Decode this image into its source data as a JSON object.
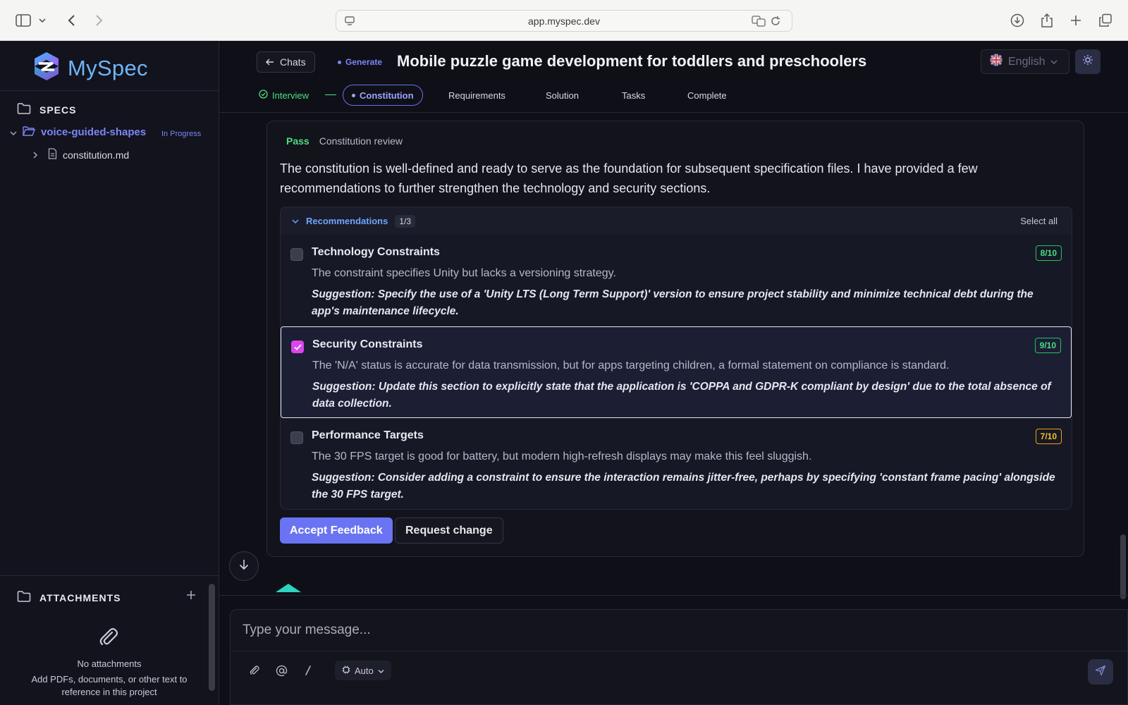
{
  "browser": {
    "url": "app.myspec.dev"
  },
  "sidebar": {
    "logo_text": "MySpec",
    "specs_heading": "SPECS",
    "project": {
      "name": "voice-guided-shapes",
      "status": "In Progress"
    },
    "files": [
      {
        "name": "constitution.md"
      }
    ],
    "attachments": {
      "heading": "ATTACHMENTS",
      "empty_title": "No attachments",
      "empty_hint": "Add PDFs, documents, or other text to reference in this project"
    }
  },
  "header": {
    "back_label": "Chats",
    "mode_tag": "Generate",
    "title": "Mobile puzzle game development for toddlers and preschoolers",
    "language": "English"
  },
  "steps": [
    {
      "label": "Interview",
      "state": "done"
    },
    {
      "label": "Constitution",
      "state": "active"
    },
    {
      "label": "Requirements",
      "state": "pending"
    },
    {
      "label": "Solution",
      "state": "pending"
    },
    {
      "label": "Tasks",
      "state": "pending"
    },
    {
      "label": "Complete",
      "state": "pending"
    }
  ],
  "review": {
    "status": "Pass",
    "label": "Constitution review",
    "summary": "The constitution is well-defined and ready to serve as the foundation for subsequent specification files. I have provided a few recommendations to further strengthen the technology and security sections.",
    "recommendations": {
      "title": "Recommendations",
      "count": "1/3",
      "select_all": "Select all",
      "items": [
        {
          "title": "Technology Constraints",
          "score": "8/10",
          "checked": false,
          "description": "The constraint specifies Unity but lacks a versioning strategy.",
          "suggestion": "Suggestion: Specify the use of a 'Unity LTS (Long Term Support)' version to ensure project stability and minimize technical debt during the app's maintenance lifecycle."
        },
        {
          "title": "Security Constraints",
          "score": "9/10",
          "checked": true,
          "description": "The 'N/A' status is accurate for data transmission, but for apps targeting children, a formal statement on compliance is standard.",
          "suggestion": "Suggestion: Update this section to explicitly state that the application is 'COPPA and GDPR-K compliant by design' due to the total absence of data collection."
        },
        {
          "title": "Performance Targets",
          "score": "7/10",
          "checked": false,
          "description": "The 30 FPS target is good for battery, but modern high-refresh displays may make this feel sluggish.",
          "suggestion": "Suggestion: Consider adding a constraint to ensure the interaction remains jitter-free, perhaps by specifying 'constant frame pacing' alongside the 30 FPS target."
        }
      ]
    },
    "accept_label": "Accept Feedback",
    "request_label": "Request change"
  },
  "composer": {
    "placeholder": "Type your message...",
    "model": "Auto"
  },
  "colors": {
    "accent": "#6a74f2",
    "success": "#4ade80",
    "warning": "#fbbf24",
    "checkbox_on": "#d946ef"
  }
}
